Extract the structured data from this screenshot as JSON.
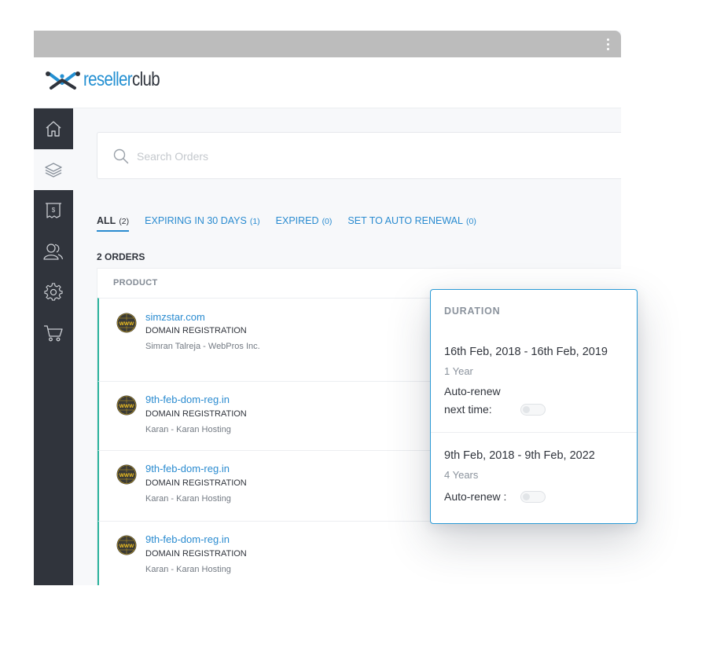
{
  "app": {
    "logo_text_1": "reseller",
    "logo_text_2": "club"
  },
  "sidebar": {
    "items": [
      {
        "icon": "home-icon"
      },
      {
        "icon": "layers-icon",
        "active": true
      },
      {
        "icon": "billing-icon"
      },
      {
        "icon": "users-icon"
      },
      {
        "icon": "gear-icon"
      },
      {
        "icon": "cart-icon"
      }
    ]
  },
  "search": {
    "placeholder": "Search Orders"
  },
  "tabs": [
    {
      "label": "ALL",
      "count": "(2)",
      "active": true
    },
    {
      "label": "EXPIRING IN 30 DAYS",
      "count": "(1)"
    },
    {
      "label": "EXPIRED",
      "count": "(0)"
    },
    {
      "label": "SET TO AUTO RENEWAL",
      "count": "(0)"
    }
  ],
  "orders_count": "2 ORDERS",
  "table": {
    "header_product": "PRODUCT",
    "rows": [
      {
        "domain": "simzstar.com",
        "type": "DOMAIN REGISTRATION",
        "customer": "Simran Talreja - WebPros Inc."
      },
      {
        "domain": "9th-feb-dom-reg.in",
        "type": "DOMAIN REGISTRATION",
        "customer": "Karan - Karan Hosting"
      },
      {
        "domain": "9th-feb-dom-reg.in",
        "type": "DOMAIN REGISTRATION",
        "customer": "Karan - Karan Hosting"
      },
      {
        "domain": "9th-feb-dom-reg.in",
        "type": "DOMAIN REGISTRATION",
        "customer": "Karan - Karan Hosting"
      }
    ]
  },
  "duration_popup": {
    "header": "DURATION",
    "entries": [
      {
        "range": "16th Feb, 2018 - 16th Feb, 2019",
        "years": "1 Year",
        "auto_renew_line1": "Auto-renew",
        "auto_renew_line2": "next time:",
        "auto_renew_on": false
      },
      {
        "range": "9th Feb, 2018 - 9th Feb, 2022",
        "years": "4 Years",
        "auto_renew_label": "Auto-renew :",
        "auto_renew_on": false
      }
    ]
  },
  "colors": {
    "accent": "#2a8bd0",
    "sidebar": "#30343c",
    "row_marker": "#2cb39d"
  }
}
